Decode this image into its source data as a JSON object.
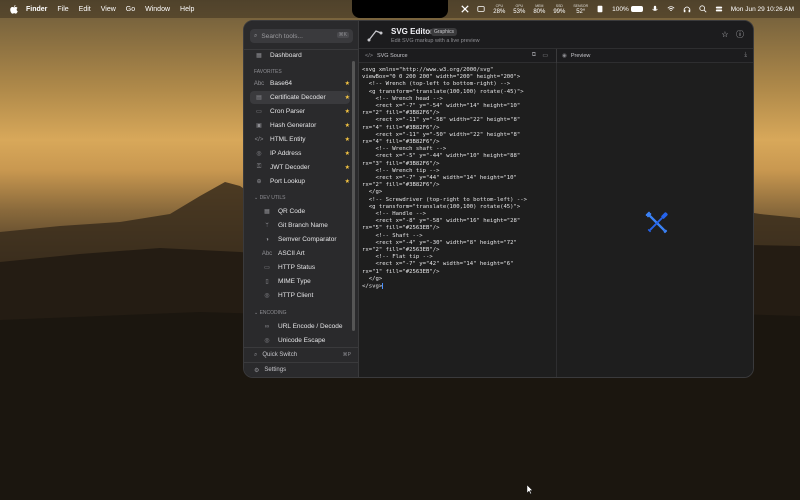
{
  "menubar": {
    "app_name": "Finder",
    "items": [
      "File",
      "Edit",
      "View",
      "Go",
      "Window",
      "Help"
    ],
    "stats": [
      {
        "label": "CPU",
        "value": "28%"
      },
      {
        "label": "GPU",
        "value": "53%"
      },
      {
        "label": "MEM",
        "value": "80%"
      },
      {
        "label": "SSD",
        "value": "99%"
      },
      {
        "label": "SENSOR",
        "value": "52°"
      }
    ],
    "battery": "100%",
    "datetime": "Mon Jun 29  10:26 AM"
  },
  "sidebar": {
    "search_placeholder": "Search tools...",
    "search_shortcut": "⌘K",
    "dashboard": "Dashboard",
    "favorites_label": "Favorites",
    "favorites": [
      {
        "icon": "abc-icon",
        "label": "Base64"
      },
      {
        "icon": "certificate-icon",
        "label": "Certificate Decoder"
      },
      {
        "icon": "clock-icon",
        "label": "Cron Parser"
      },
      {
        "icon": "hash-icon",
        "label": "Hash Generator"
      },
      {
        "icon": "code-icon",
        "label": "HTML Entity"
      },
      {
        "icon": "globe-icon",
        "label": "IP Address"
      },
      {
        "icon": "key-icon",
        "label": "JWT Decoder"
      },
      {
        "icon": "network-icon",
        "label": "Port Lookup"
      }
    ],
    "dev_utils_label": "DEV UTILS",
    "dev_utils": [
      {
        "icon": "qr-icon",
        "label": "QR Code"
      },
      {
        "icon": "branch-icon",
        "label": "Git Branch Name"
      },
      {
        "icon": "compare-icon",
        "label": "Semver Comparator"
      },
      {
        "icon": "abc-icon",
        "label": "ASCII Art"
      },
      {
        "icon": "status-icon",
        "label": "HTTP Status"
      },
      {
        "icon": "file-icon",
        "label": "MIME Type"
      },
      {
        "icon": "globe-icon",
        "label": "HTTP Client"
      }
    ],
    "encoding_label": "ENCODING",
    "encoding": [
      {
        "icon": "link-icon",
        "label": "URL Encode / Decode"
      },
      {
        "icon": "escape-icon",
        "label": "Unicode Escape"
      }
    ],
    "quick_switch": "Quick Switch",
    "quick_switch_shortcut": "⌘P",
    "settings": "Settings"
  },
  "header": {
    "title": "SVG Editor",
    "badge": "Graphics",
    "subtitle": "Edit SVG markup with a live preview"
  },
  "source_pane": {
    "label": "SVG Source"
  },
  "preview_pane": {
    "label": "Preview"
  },
  "code_lines": [
    "<svg xmlns=\"http://www.w3.org/2000/svg\"",
    "viewBox=\"0 0 200 200\" width=\"200\" height=\"200\">",
    "  <!-- Wrench (top-left to bottom-right) -->",
    "  <g transform=\"translate(100,100) rotate(-45)\">",
    "    <!-- Wrench head -->",
    "    <rect x=\"-7\" y=\"-54\" width=\"14\" height=\"10\"",
    "rx=\"2\" fill=\"#3B82F6\"/>",
    "    <rect x=\"-11\" y=\"-58\" width=\"22\" height=\"8\"",
    "rx=\"4\" fill=\"#3B82F6\"/>",
    "    <rect x=\"-11\" y=\"-50\" width=\"22\" height=\"8\"",
    "rx=\"4\" fill=\"#3B82F6\"/>",
    "    <!-- Wrench shaft -->",
    "    <rect x=\"-5\" y=\"-44\" width=\"10\" height=\"88\"",
    "rx=\"3\" fill=\"#3B82F6\"/>",
    "    <!-- Wrench tip -->",
    "    <rect x=\"-7\" y=\"44\" width=\"14\" height=\"10\"",
    "rx=\"2\" fill=\"#3B82F6\"/>",
    "  </g>",
    "  <!-- Screwdriver (top-right to bottom-left) -->",
    "  <g transform=\"translate(100,100) rotate(45)\">",
    "    <!-- Handle -->",
    "    <rect x=\"-8\" y=\"-58\" width=\"16\" height=\"28\"",
    "rx=\"5\" fill=\"#2563EB\"/>",
    "    <!-- Shaft -->",
    "    <rect x=\"-4\" y=\"-30\" width=\"8\" height=\"72\"",
    "rx=\"2\" fill=\"#2563EB\"/>",
    "    <!-- Flat tip -->",
    "    <rect x=\"-7\" y=\"42\" width=\"14\" height=\"6\"",
    "rx=\"1\" fill=\"#2563EB\"/>",
    "  </g>",
    "</svg>"
  ],
  "colors": {
    "wrench": "#3B82F6",
    "screwdriver": "#2563EB",
    "star": "#F5C542"
  }
}
